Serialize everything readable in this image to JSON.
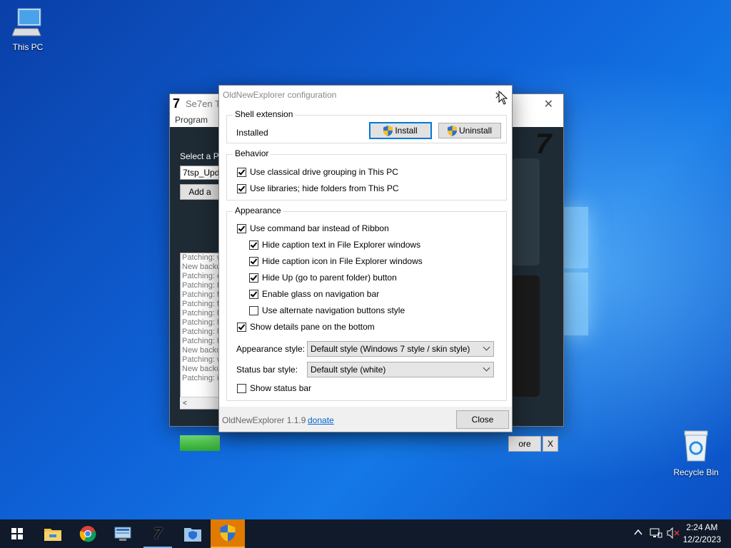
{
  "desktop": {
    "icons": [
      {
        "label": "This PC"
      },
      {
        "label": "Recycle Bin"
      }
    ]
  },
  "bg_window": {
    "title": "Se7en Th",
    "menu": [
      "Program",
      "("
    ],
    "select_label": "Select a Pa",
    "input_value": "7tsp_Updat",
    "add_button": "Add a",
    "log_lines": [
      "Patching: w",
      "New backu",
      "Patching: e",
      "Patching: F",
      "Patching: fo",
      "Patching: fo",
      "Patching: h",
      "Patching: h",
      "Patching: h",
      "Patching: h",
      "New backu",
      "Patching: w",
      "New backu",
      "Patching: ir"
    ],
    "restore_button": "ore",
    "x_button": "X"
  },
  "dialog": {
    "title": "OldNewExplorer configuration",
    "shell": {
      "legend": "Shell extension",
      "status": "Installed",
      "install": "Install",
      "uninstall": "Uninstall"
    },
    "behavior": {
      "legend": "Behavior",
      "items": [
        {
          "label": "Use classical drive grouping in This PC",
          "checked": true
        },
        {
          "label": "Use libraries; hide folders from This PC",
          "checked": true
        }
      ]
    },
    "appearance": {
      "legend": "Appearance",
      "items": [
        {
          "label": "Use command bar instead of Ribbon",
          "checked": true
        },
        {
          "label": "Hide caption text in File Explorer windows",
          "checked": true
        },
        {
          "label": "Hide caption icon in File Explorer windows",
          "checked": true
        },
        {
          "label": "Hide Up (go to parent folder) button",
          "checked": true
        },
        {
          "label": "Enable glass on navigation bar",
          "checked": true
        },
        {
          "label": "Use alternate navigation buttons style",
          "checked": false
        },
        {
          "label": "Show details pane on the bottom",
          "checked": true
        }
      ],
      "style_label": "Appearance style:",
      "style_value": "Default style (Windows 7 style / skin style)",
      "status_label": "Status bar style:",
      "status_value": "Default style (white)",
      "show_status": {
        "label": "Show status bar",
        "checked": false
      }
    },
    "footer": {
      "version": "OldNewExplorer 1.1.9",
      "donate": "donate",
      "close": "Close"
    }
  },
  "taskbar": {
    "apps": [
      "start-icon",
      "file-explorer-icon",
      "chrome-icon",
      "control-panel-icon",
      "7tsp-icon",
      "security-icon",
      "oldnewexplorer-icon"
    ],
    "time": "2:24 AM",
    "date": "12/2/2023",
    "colors": {
      "active": "#e17a00",
      "bar": "#101a2a"
    }
  }
}
